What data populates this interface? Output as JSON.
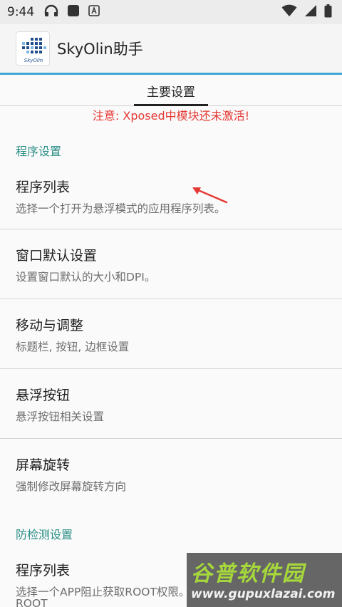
{
  "status_bar": {
    "time": "9:44",
    "icons_left": [
      "headphones-icon",
      "app-square-icon",
      "font-app-icon"
    ],
    "icons_right": [
      "wifi-icon",
      "cellular-icon",
      "battery-icon"
    ]
  },
  "app_bar": {
    "title": "SkyOlin助手",
    "logo_text": "SkyOlin",
    "accent_color": "#3fa6d6"
  },
  "tabs": [
    {
      "label": "主要设置",
      "selected": true
    }
  ],
  "warning": {
    "text": "注意: Xposed中模块还未激活!",
    "color": "#e53935"
  },
  "sections": [
    {
      "header": "程序设置",
      "items": [
        {
          "title": "程序列表",
          "summary": "选择一个打开为悬浮模式的应用程序列表。"
        },
        {
          "title": "窗口默认设置",
          "summary": "设置窗口默认的大小和DPI。"
        },
        {
          "title": "移动与调整",
          "summary": "标题栏, 按钮, 边框设置"
        },
        {
          "title": "悬浮按钮",
          "summary": "悬浮按钮相关设置"
        },
        {
          "title": "屏幕旋转",
          "summary": "强制修改屏幕旋转方向"
        }
      ]
    },
    {
      "header": "防检测设置",
      "items": [
        {
          "title": "程序列表",
          "summary": "选择一个APP阻止获取ROOT权限。"
        },
        {
          "title": "",
          "summary": "ROOT"
        }
      ]
    }
  ],
  "watermark": {
    "title": "谷普软件园",
    "url": "www.gupuxlazai.com"
  },
  "colors": {
    "category": "#2a8f86",
    "annotation_arrow": "#e53935"
  }
}
